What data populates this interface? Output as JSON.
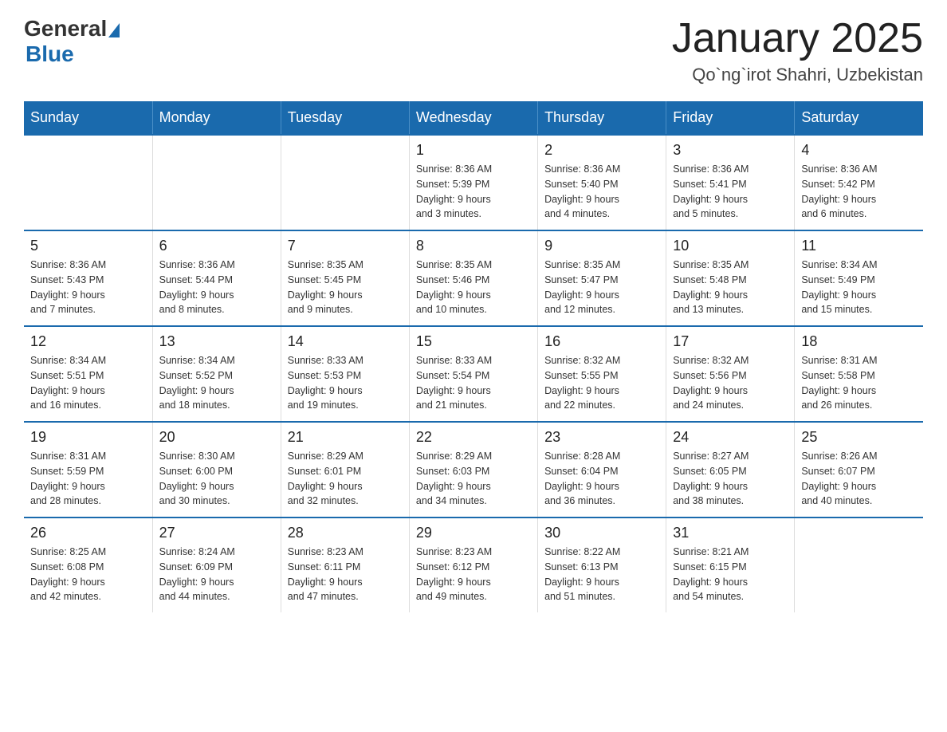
{
  "header": {
    "logo_general": "General",
    "logo_blue": "Blue",
    "month_title": "January 2025",
    "location": "Qo`ng`irot Shahri, Uzbekistan"
  },
  "days_of_week": [
    "Sunday",
    "Monday",
    "Tuesday",
    "Wednesday",
    "Thursday",
    "Friday",
    "Saturday"
  ],
  "weeks": [
    [
      {
        "day": "",
        "info": ""
      },
      {
        "day": "",
        "info": ""
      },
      {
        "day": "",
        "info": ""
      },
      {
        "day": "1",
        "info": "Sunrise: 8:36 AM\nSunset: 5:39 PM\nDaylight: 9 hours\nand 3 minutes."
      },
      {
        "day": "2",
        "info": "Sunrise: 8:36 AM\nSunset: 5:40 PM\nDaylight: 9 hours\nand 4 minutes."
      },
      {
        "day": "3",
        "info": "Sunrise: 8:36 AM\nSunset: 5:41 PM\nDaylight: 9 hours\nand 5 minutes."
      },
      {
        "day": "4",
        "info": "Sunrise: 8:36 AM\nSunset: 5:42 PM\nDaylight: 9 hours\nand 6 minutes."
      }
    ],
    [
      {
        "day": "5",
        "info": "Sunrise: 8:36 AM\nSunset: 5:43 PM\nDaylight: 9 hours\nand 7 minutes."
      },
      {
        "day": "6",
        "info": "Sunrise: 8:36 AM\nSunset: 5:44 PM\nDaylight: 9 hours\nand 8 minutes."
      },
      {
        "day": "7",
        "info": "Sunrise: 8:35 AM\nSunset: 5:45 PM\nDaylight: 9 hours\nand 9 minutes."
      },
      {
        "day": "8",
        "info": "Sunrise: 8:35 AM\nSunset: 5:46 PM\nDaylight: 9 hours\nand 10 minutes."
      },
      {
        "day": "9",
        "info": "Sunrise: 8:35 AM\nSunset: 5:47 PM\nDaylight: 9 hours\nand 12 minutes."
      },
      {
        "day": "10",
        "info": "Sunrise: 8:35 AM\nSunset: 5:48 PM\nDaylight: 9 hours\nand 13 minutes."
      },
      {
        "day": "11",
        "info": "Sunrise: 8:34 AM\nSunset: 5:49 PM\nDaylight: 9 hours\nand 15 minutes."
      }
    ],
    [
      {
        "day": "12",
        "info": "Sunrise: 8:34 AM\nSunset: 5:51 PM\nDaylight: 9 hours\nand 16 minutes."
      },
      {
        "day": "13",
        "info": "Sunrise: 8:34 AM\nSunset: 5:52 PM\nDaylight: 9 hours\nand 18 minutes."
      },
      {
        "day": "14",
        "info": "Sunrise: 8:33 AM\nSunset: 5:53 PM\nDaylight: 9 hours\nand 19 minutes."
      },
      {
        "day": "15",
        "info": "Sunrise: 8:33 AM\nSunset: 5:54 PM\nDaylight: 9 hours\nand 21 minutes."
      },
      {
        "day": "16",
        "info": "Sunrise: 8:32 AM\nSunset: 5:55 PM\nDaylight: 9 hours\nand 22 minutes."
      },
      {
        "day": "17",
        "info": "Sunrise: 8:32 AM\nSunset: 5:56 PM\nDaylight: 9 hours\nand 24 minutes."
      },
      {
        "day": "18",
        "info": "Sunrise: 8:31 AM\nSunset: 5:58 PM\nDaylight: 9 hours\nand 26 minutes."
      }
    ],
    [
      {
        "day": "19",
        "info": "Sunrise: 8:31 AM\nSunset: 5:59 PM\nDaylight: 9 hours\nand 28 minutes."
      },
      {
        "day": "20",
        "info": "Sunrise: 8:30 AM\nSunset: 6:00 PM\nDaylight: 9 hours\nand 30 minutes."
      },
      {
        "day": "21",
        "info": "Sunrise: 8:29 AM\nSunset: 6:01 PM\nDaylight: 9 hours\nand 32 minutes."
      },
      {
        "day": "22",
        "info": "Sunrise: 8:29 AM\nSunset: 6:03 PM\nDaylight: 9 hours\nand 34 minutes."
      },
      {
        "day": "23",
        "info": "Sunrise: 8:28 AM\nSunset: 6:04 PM\nDaylight: 9 hours\nand 36 minutes."
      },
      {
        "day": "24",
        "info": "Sunrise: 8:27 AM\nSunset: 6:05 PM\nDaylight: 9 hours\nand 38 minutes."
      },
      {
        "day": "25",
        "info": "Sunrise: 8:26 AM\nSunset: 6:07 PM\nDaylight: 9 hours\nand 40 minutes."
      }
    ],
    [
      {
        "day": "26",
        "info": "Sunrise: 8:25 AM\nSunset: 6:08 PM\nDaylight: 9 hours\nand 42 minutes."
      },
      {
        "day": "27",
        "info": "Sunrise: 8:24 AM\nSunset: 6:09 PM\nDaylight: 9 hours\nand 44 minutes."
      },
      {
        "day": "28",
        "info": "Sunrise: 8:23 AM\nSunset: 6:11 PM\nDaylight: 9 hours\nand 47 minutes."
      },
      {
        "day": "29",
        "info": "Sunrise: 8:23 AM\nSunset: 6:12 PM\nDaylight: 9 hours\nand 49 minutes."
      },
      {
        "day": "30",
        "info": "Sunrise: 8:22 AM\nSunset: 6:13 PM\nDaylight: 9 hours\nand 51 minutes."
      },
      {
        "day": "31",
        "info": "Sunrise: 8:21 AM\nSunset: 6:15 PM\nDaylight: 9 hours\nand 54 minutes."
      },
      {
        "day": "",
        "info": ""
      }
    ]
  ]
}
